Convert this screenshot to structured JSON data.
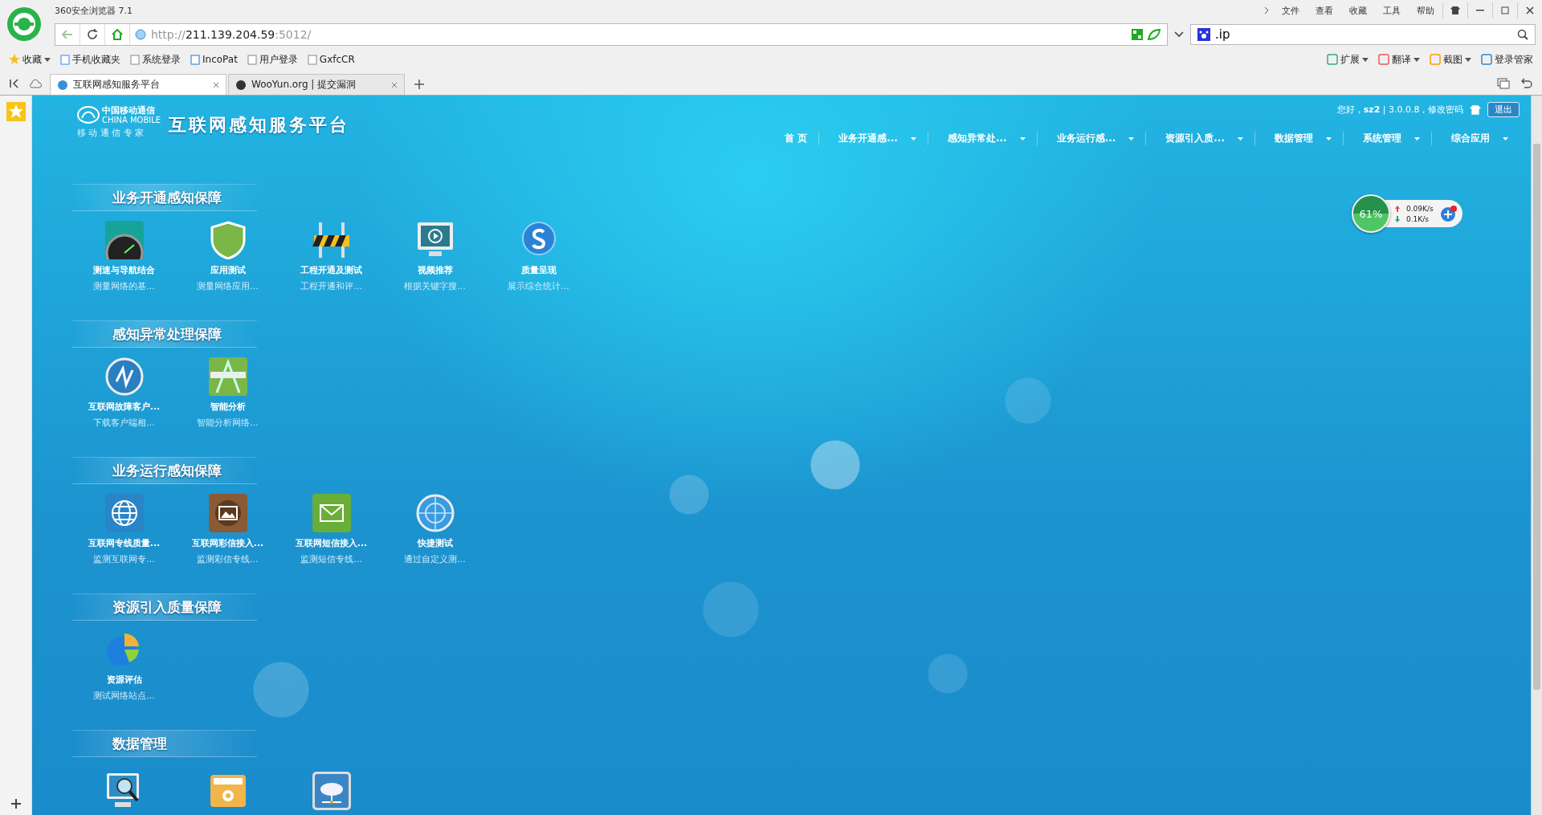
{
  "browser": {
    "title": "360安全浏览器 7.1",
    "menu": [
      "文件",
      "查看",
      "收藏",
      "工具",
      "帮助"
    ],
    "address": {
      "scheme": "http://",
      "host": "211.139.204.59",
      "rest": ":5012/"
    },
    "search": {
      "value": ".ip"
    },
    "bookmarks": [
      "收藏",
      "手机收藏夹",
      "系统登录",
      "IncoPat",
      "用户登录",
      "GxfcCR"
    ],
    "tools": [
      "扩展",
      "翻译",
      "截图",
      "登录管家"
    ],
    "tabs": [
      {
        "label": "互联网感知服务平台",
        "selected": true
      },
      {
        "label": "WooYun.org | 提交漏洞",
        "selected": false
      }
    ]
  },
  "page": {
    "logo": {
      "cn": "中国移动通信",
      "en": "CHINA MOBILE",
      "slogan": "移 动 通 信 专 家"
    },
    "title": "互联网感知服务平台",
    "user_info": "您好，**sz2** | 3.0.0.8 , 修改密码",
    "logout": "退出",
    "nav": [
      {
        "label": "首 页",
        "dropdown": false
      },
      {
        "label": "业务开通感...",
        "dropdown": true
      },
      {
        "label": "感知异常处...",
        "dropdown": true
      },
      {
        "label": "业务运行感...",
        "dropdown": true
      },
      {
        "label": "资源引入质...",
        "dropdown": true
      },
      {
        "label": "数据管理",
        "dropdown": true
      },
      {
        "label": "系统管理",
        "dropdown": true
      },
      {
        "label": "综合应用",
        "dropdown": true
      }
    ],
    "sections": [
      {
        "title": "业务开通感知保障",
        "apps": [
          {
            "label": "测速与导航结合",
            "desc": "测量网络的基..."
          },
          {
            "label": "应用测试",
            "desc": "测量网络应用..."
          },
          {
            "label": "工程开通及测试",
            "desc": "工程开通和评..."
          },
          {
            "label": "视频推荐",
            "desc": "根据关键字搜..."
          },
          {
            "label": "质量呈现",
            "desc": "展示综合统计..."
          }
        ]
      },
      {
        "title": "感知异常处理保障",
        "apps": [
          {
            "label": "互联网故障客户...",
            "desc": "下载客户端相..."
          },
          {
            "label": "智能分析",
            "desc": "智能分析网络..."
          }
        ]
      },
      {
        "title": "业务运行感知保障",
        "apps": [
          {
            "label": "互联网专线质量...",
            "desc": "监测互联网专..."
          },
          {
            "label": "互联网彩信接入...",
            "desc": "监测彩信专线..."
          },
          {
            "label": "互联网短信接入...",
            "desc": "监测短信专线..."
          },
          {
            "label": "快捷测试",
            "desc": "通过自定义测..."
          }
        ]
      },
      {
        "title": "资源引入质量保障",
        "apps": [
          {
            "label": "资源评估",
            "desc": "测试网络站点..."
          }
        ]
      },
      {
        "title": "数据管理",
        "apps": [
          {
            "kind": "cut"
          },
          {
            "kind": "cut"
          },
          {
            "kind": "cut"
          }
        ]
      }
    ],
    "speed_widget": {
      "percent": "61%",
      "up": "0.09K/s",
      "down": "0.1K/s"
    }
  }
}
